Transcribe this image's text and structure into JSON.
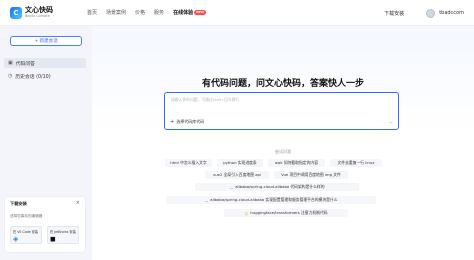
{
  "brand": {
    "title": "文心快码",
    "subtitle": "Baidu Comate",
    "mark": "C"
  },
  "nav": [
    {
      "label": "首页"
    },
    {
      "label": "场景案例"
    },
    {
      "label": "价格"
    },
    {
      "label": "服务"
    },
    {
      "label": "在线体验",
      "badge": "NEW"
    }
  ],
  "top_right": {
    "download": "下载安装",
    "username": "tbadccom"
  },
  "sidebar": {
    "new_chat": "+ 新建会话",
    "items": [
      {
        "label": "代码问答",
        "icon": "▣"
      },
      {
        "label": "历史会话 (0/10)",
        "icon": "◷"
      }
    ],
    "download_card": {
      "title": "下载安装",
      "close": "×",
      "subtitle": "选择您喜欢的编辑器",
      "vscode": "在 VS Code 安装",
      "jetbrains": "在 JetBrains 安装",
      "vscode_icon": "◈",
      "jetbrains_icon": "◼"
    }
  },
  "main": {
    "headline": "有代码问题，问文心快码，答案快人一步",
    "placeholder": "请输入你的问题，可通过shift+回车换行",
    "select_code": "选择代码库代码",
    "send": "↵",
    "try_title": "尝试问我",
    "chips": [
      {
        "text": "html 中怎么插入文字"
      },
      {
        "text": "python 实现进度条"
      },
      {
        "text": "awk 如何截取指定的内容"
      },
      {
        "text": "文件去重复一行 linux"
      },
      {
        "text": "vue2 全局引入百度地图 api"
      },
      {
        "text": "Vue 项目中调用百度地图 img 文件"
      },
      {
        "text": "alibaba/spring-cloud-alibaba 代码架构是什么样的"
      },
      {
        "text": "alibaba/spring-cloud-alibaba 实现配置管理和服务管理平台的模块是什么"
      },
      {
        "text": "huggingface/transformers 注意力机制代码"
      }
    ]
  }
}
